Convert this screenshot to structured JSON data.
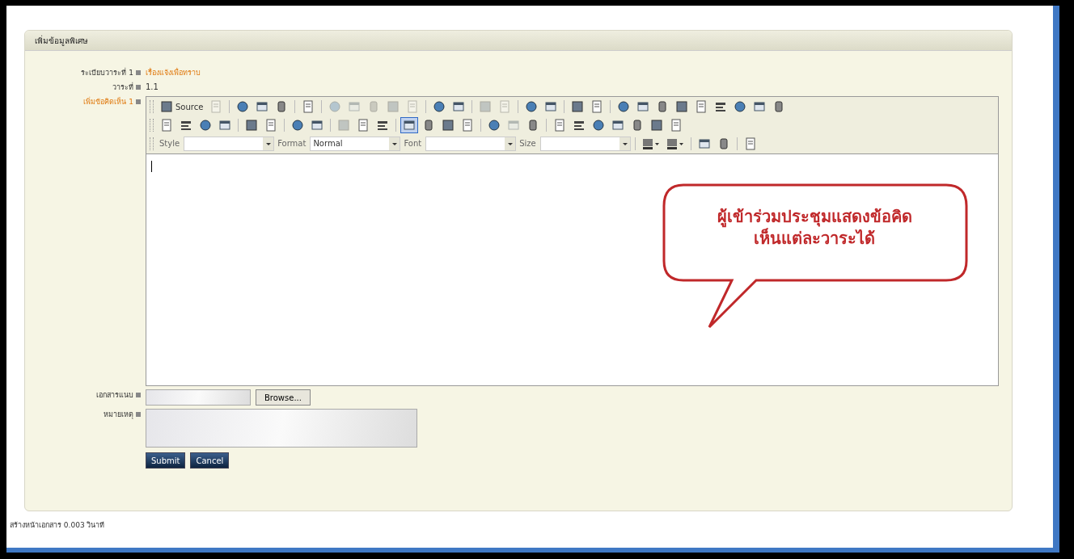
{
  "panel": {
    "title": "เพิ่มข้อมูลพิเศษ"
  },
  "fields": [
    {
      "label": "ระเบียบวาระที่ 1",
      "required": false,
      "value": "เรื่องแจ้งเพื่อทราบ",
      "kind": "link"
    },
    {
      "label": "วาระที่",
      "required": false,
      "value": "1.1",
      "kind": "text"
    },
    {
      "label": "เพิ่มข้อคิดเห็น 1",
      "required": true,
      "kind": "editor"
    }
  ],
  "toolbar_rows": [
    [
      {
        "kind": "button",
        "label": "Source",
        "disabled": false,
        "selected": false
      },
      {
        "kind": "button",
        "disabled": true,
        "selected": false
      },
      {
        "kind": "separator"
      },
      {
        "kind": "button",
        "disabled": false,
        "selected": false
      },
      {
        "kind": "button",
        "disabled": false,
        "selected": false
      },
      {
        "kind": "button",
        "disabled": false,
        "selected": false
      },
      {
        "kind": "separator"
      },
      {
        "kind": "button",
        "disabled": false,
        "selected": false
      },
      {
        "kind": "separator"
      },
      {
        "kind": "button",
        "disabled": true,
        "selected": false
      },
      {
        "kind": "button",
        "disabled": true,
        "selected": false
      },
      {
        "kind": "button",
        "disabled": true,
        "selected": false
      },
      {
        "kind": "button",
        "disabled": true,
        "selected": false
      },
      {
        "kind": "button",
        "disabled": true,
        "selected": false
      },
      {
        "kind": "separator"
      },
      {
        "kind": "button",
        "disabled": false,
        "selected": false
      },
      {
        "kind": "button",
        "disabled": false,
        "selected": false
      },
      {
        "kind": "separator"
      },
      {
        "kind": "button",
        "disabled": true,
        "selected": false
      },
      {
        "kind": "button",
        "disabled": true,
        "selected": false
      },
      {
        "kind": "separator"
      },
      {
        "kind": "button",
        "disabled": false,
        "selected": false
      },
      {
        "kind": "button",
        "disabled": false,
        "selected": false
      },
      {
        "kind": "separator"
      },
      {
        "kind": "button",
        "disabled": false,
        "selected": false
      },
      {
        "kind": "button",
        "disabled": false,
        "selected": false
      },
      {
        "kind": "separator"
      },
      {
        "kind": "button",
        "disabled": false,
        "selected": false
      },
      {
        "kind": "button",
        "disabled": false,
        "selected": false
      },
      {
        "kind": "button",
        "disabled": false,
        "selected": false
      },
      {
        "kind": "button",
        "disabled": false,
        "selected": false
      },
      {
        "kind": "button",
        "disabled": false,
        "selected": false
      },
      {
        "kind": "button",
        "disabled": false,
        "selected": false
      },
      {
        "kind": "button",
        "disabled": false,
        "selected": false
      },
      {
        "kind": "button",
        "disabled": false,
        "selected": false
      },
      {
        "kind": "button",
        "disabled": false,
        "selected": false
      }
    ],
    [
      {
        "kind": "button",
        "disabled": false,
        "selected": false
      },
      {
        "kind": "button",
        "disabled": false,
        "selected": false
      },
      {
        "kind": "button",
        "disabled": false,
        "selected": false
      },
      {
        "kind": "button",
        "disabled": false,
        "selected": false
      },
      {
        "kind": "separator"
      },
      {
        "kind": "button",
        "disabled": false,
        "selected": false
      },
      {
        "kind": "button",
        "disabled": false,
        "selected": false
      },
      {
        "kind": "separator"
      },
      {
        "kind": "button",
        "disabled": false,
        "selected": false
      },
      {
        "kind": "button",
        "disabled": false,
        "selected": false
      },
      {
        "kind": "separator"
      },
      {
        "kind": "button",
        "disabled": true,
        "selected": false
      },
      {
        "kind": "button",
        "disabled": false,
        "selected": false
      },
      {
        "kind": "button",
        "disabled": false,
        "selected": false
      },
      {
        "kind": "separator"
      },
      {
        "kind": "button",
        "disabled": false,
        "selected": true
      },
      {
        "kind": "button",
        "disabled": false,
        "selected": false
      },
      {
        "kind": "button",
        "disabled": false,
        "selected": false
      },
      {
        "kind": "button",
        "disabled": false,
        "selected": false
      },
      {
        "kind": "separator"
      },
      {
        "kind": "button",
        "disabled": false,
        "selected": false
      },
      {
        "kind": "button",
        "disabled": true,
        "selected": false
      },
      {
        "kind": "button",
        "disabled": false,
        "selected": false
      },
      {
        "kind": "separator"
      },
      {
        "kind": "button",
        "disabled": false,
        "selected": false
      },
      {
        "kind": "button",
        "disabled": false,
        "selected": false
      },
      {
        "kind": "button",
        "disabled": false,
        "selected": false
      },
      {
        "kind": "button",
        "disabled": false,
        "selected": false
      },
      {
        "kind": "button",
        "disabled": false,
        "selected": false
      },
      {
        "kind": "button",
        "disabled": false,
        "selected": false
      },
      {
        "kind": "button",
        "disabled": false,
        "selected": false
      }
    ],
    [
      {
        "kind": "combo",
        "label": "Style"
      },
      {
        "kind": "combo",
        "label": "Format",
        "value": "Normal"
      },
      {
        "kind": "combo",
        "label": "Font"
      },
      {
        "kind": "combo",
        "label": "Size"
      },
      {
        "kind": "separator"
      },
      {
        "kind": "dropdown"
      },
      {
        "kind": "dropdown"
      },
      {
        "kind": "separator"
      },
      {
        "kind": "button",
        "disabled": false,
        "selected": false
      },
      {
        "kind": "button",
        "disabled": false,
        "selected": false
      },
      {
        "kind": "separator"
      },
      {
        "kind": "button",
        "disabled": false,
        "selected": false
      }
    ]
  ],
  "callout": {
    "lines": [
      "ผู้เข้าร่วมประชุมแสดงข้อคิด",
      "เห็นแต่ละวาระได้"
    ]
  },
  "attachment": {
    "label": "เอกสารแนบ",
    "button": "Browse..."
  },
  "note": {
    "label": "หมายเหตุ"
  },
  "buttons": [
    "Submit",
    "Cancel"
  ],
  "footer": "สร้างหน้าเอกสาร 0.003 วินาที"
}
